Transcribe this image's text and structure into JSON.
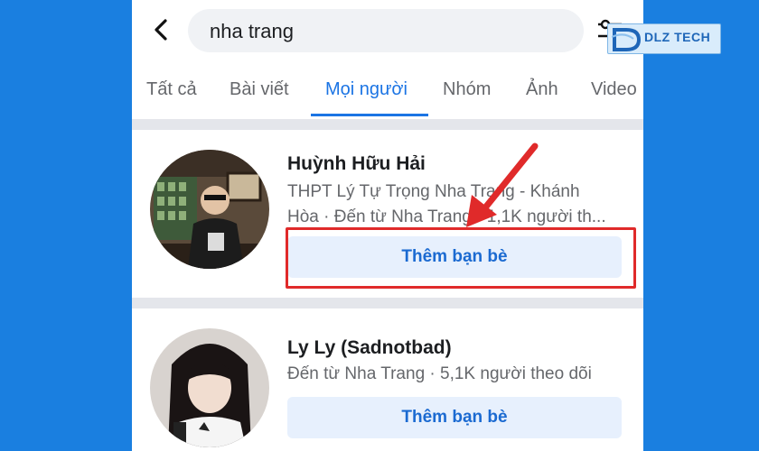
{
  "search": {
    "query": "nha trang"
  },
  "tabs": [
    {
      "label": "Tất cả"
    },
    {
      "label": "Bài viết"
    },
    {
      "label": "Mọi người"
    },
    {
      "label": "Nhóm"
    },
    {
      "label": "Ảnh"
    },
    {
      "label": "Video"
    }
  ],
  "active_tab": "Mọi người",
  "results": [
    {
      "name": "Huỳnh Hữu Hải",
      "line1": "THPT Lý Tự Trọng Nha Trang - Khánh",
      "line2": "Hòa · Đến từ Nha Trang · 1,1K người th...",
      "button": "Thêm bạn bè"
    },
    {
      "name": "Ly Ly (Sadnotbad)",
      "line1": "Đến từ Nha Trang · 5,1K người theo dõi",
      "button": "Thêm bạn bè"
    }
  ],
  "watermark": {
    "text": "DLZ TECH"
  },
  "colors": {
    "accent": "#1b74e4",
    "highlight": "#e02a2a",
    "background": "#1a7fe0"
  },
  "icons": [
    "back-arrow-icon",
    "filter-icon",
    "red-arrow-annotation"
  ]
}
